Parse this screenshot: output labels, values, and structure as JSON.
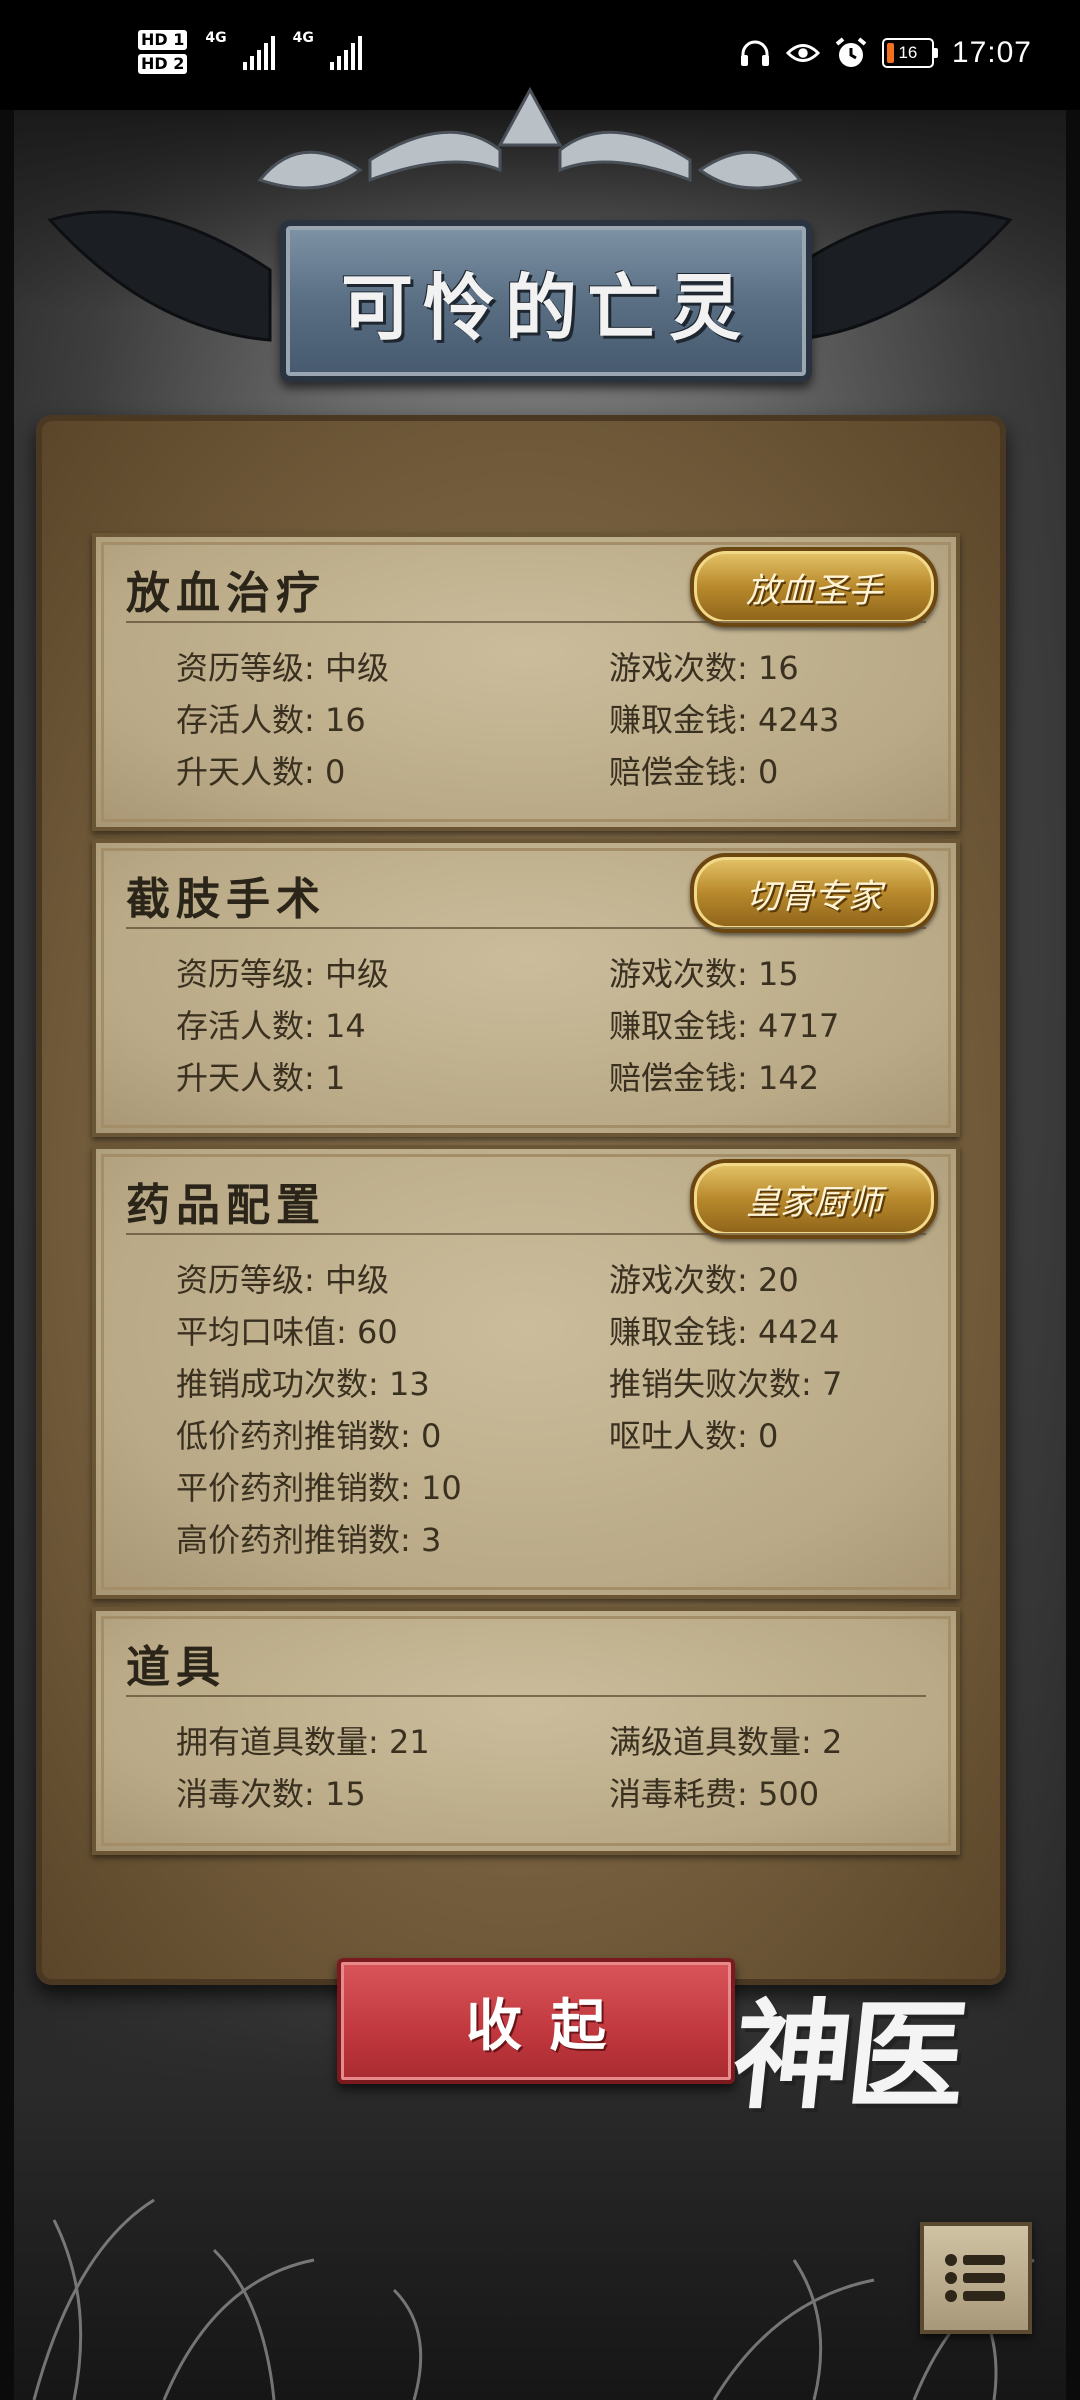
{
  "status_bar": {
    "sim1": "HD 1",
    "sim2": "HD 2",
    "network1": "4G",
    "network2": "4G",
    "battery": "16",
    "time": "17:07"
  },
  "title": "可怜的亡灵",
  "sections": [
    {
      "title": "放血治疗",
      "badge": "放血圣手",
      "stats": [
        {
          "label": "资历等级",
          "value": "中级"
        },
        {
          "label": "游戏次数",
          "value": "16"
        },
        {
          "label": "存活人数",
          "value": "16"
        },
        {
          "label": "赚取金钱",
          "value": "4243"
        },
        {
          "label": "升天人数",
          "value": "0"
        },
        {
          "label": "赔偿金钱",
          "value": "0"
        }
      ]
    },
    {
      "title": "截肢手术",
      "badge": "切骨专家",
      "stats": [
        {
          "label": "资历等级",
          "value": "中级"
        },
        {
          "label": "游戏次数",
          "value": "15"
        },
        {
          "label": "存活人数",
          "value": "14"
        },
        {
          "label": "赚取金钱",
          "value": "4717"
        },
        {
          "label": "升天人数",
          "value": "1"
        },
        {
          "label": "赔偿金钱",
          "value": "142"
        }
      ]
    },
    {
      "title": "药品配置",
      "badge": "皇家厨师",
      "stats": [
        {
          "label": "资历等级",
          "value": "中级"
        },
        {
          "label": "游戏次数",
          "value": "20"
        },
        {
          "label": "平均口味值",
          "value": "60"
        },
        {
          "label": "赚取金钱",
          "value": "4424"
        },
        {
          "label": "推销成功次数",
          "value": "13"
        },
        {
          "label": "推销失败次数",
          "value": "7"
        },
        {
          "label": "低价药剂推销数",
          "value": "0"
        },
        {
          "label": "呕吐人数",
          "value": "0"
        },
        {
          "label": "平价药剂推销数",
          "value": "10"
        },
        {
          "label": "高价药剂推销数",
          "value": "3"
        }
      ]
    },
    {
      "title": "道具",
      "stats": [
        {
          "label": "拥有道具数量",
          "value": "21"
        },
        {
          "label": "满级道具数量",
          "value": "2"
        },
        {
          "label": "消毒次数",
          "value": "15"
        },
        {
          "label": "消毒耗费",
          "value": "500"
        }
      ]
    }
  ],
  "collapse_button": "收起",
  "logo_text": "神医",
  "colors": {
    "button_red": "#c0383e",
    "badge_gold": "#b8892c",
    "parchment": "#b9a986",
    "banner_blue": "#5a6f84"
  }
}
